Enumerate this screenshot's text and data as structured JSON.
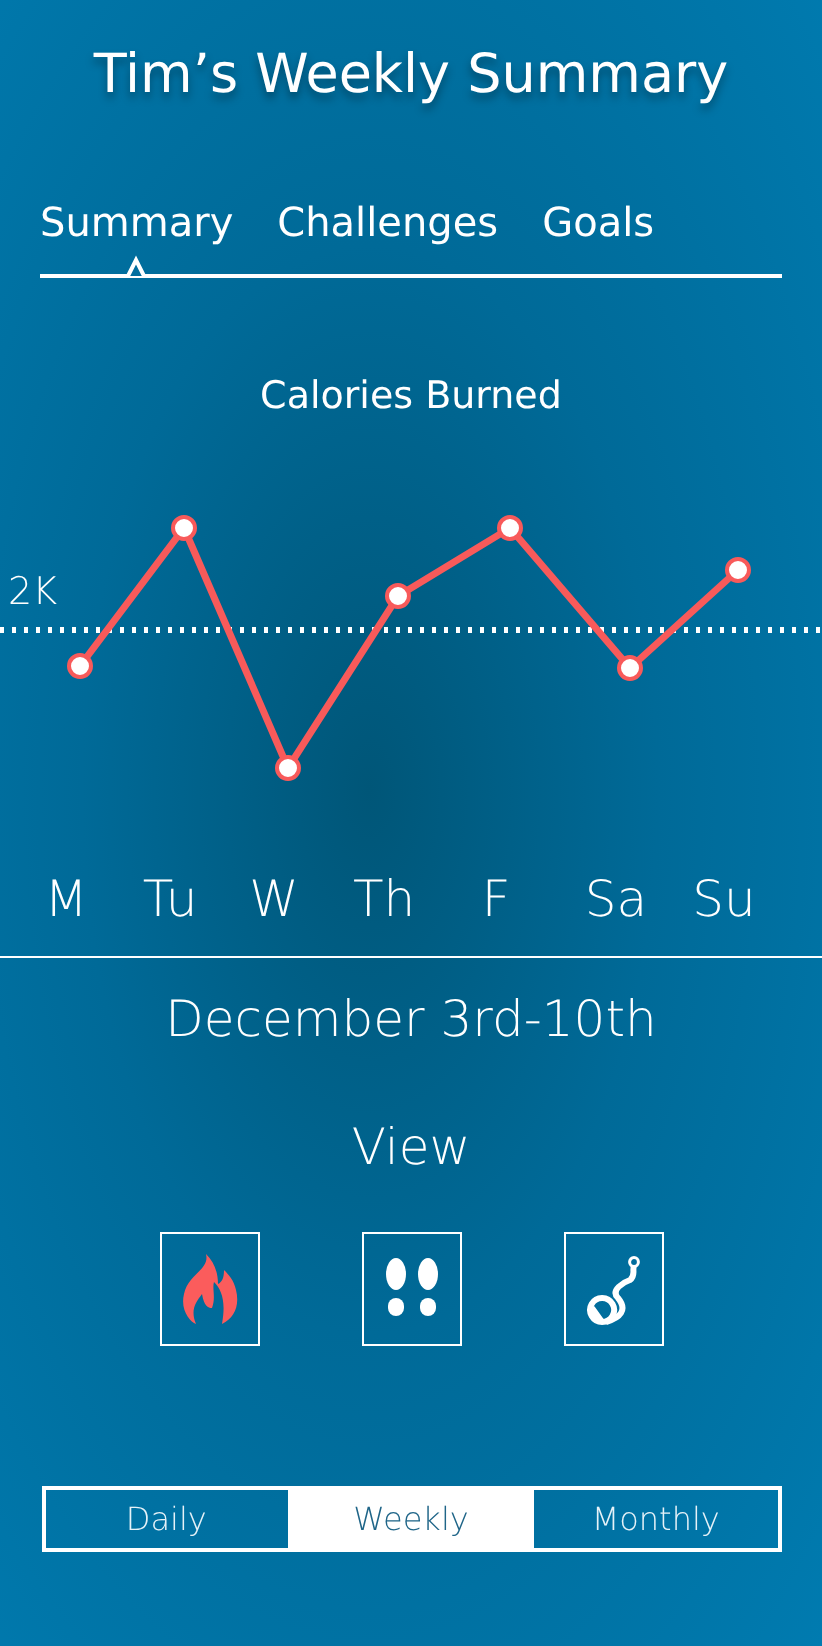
{
  "title": "Tim’s Weekly Summary",
  "tabs": [
    {
      "label": "Summary",
      "selected": true
    },
    {
      "label": "Challenges",
      "selected": false
    },
    {
      "label": "Goals",
      "selected": false
    }
  ],
  "chart": {
    "title": "Calories Burned",
    "reference_label": "2K",
    "days": [
      "M",
      "Tu",
      "W",
      "Th",
      "F",
      "Sa",
      "Su"
    ]
  },
  "date_range": "December 3rd-10th",
  "view": {
    "label": "View",
    "icons": [
      {
        "kind": "flame"
      },
      {
        "kind": "footprints"
      },
      {
        "kind": "route"
      }
    ]
  },
  "periods": [
    {
      "label": "Daily",
      "selected": false
    },
    {
      "label": "Weekly",
      "selected": true
    },
    {
      "label": "Monthly",
      "selected": false
    }
  ]
}
